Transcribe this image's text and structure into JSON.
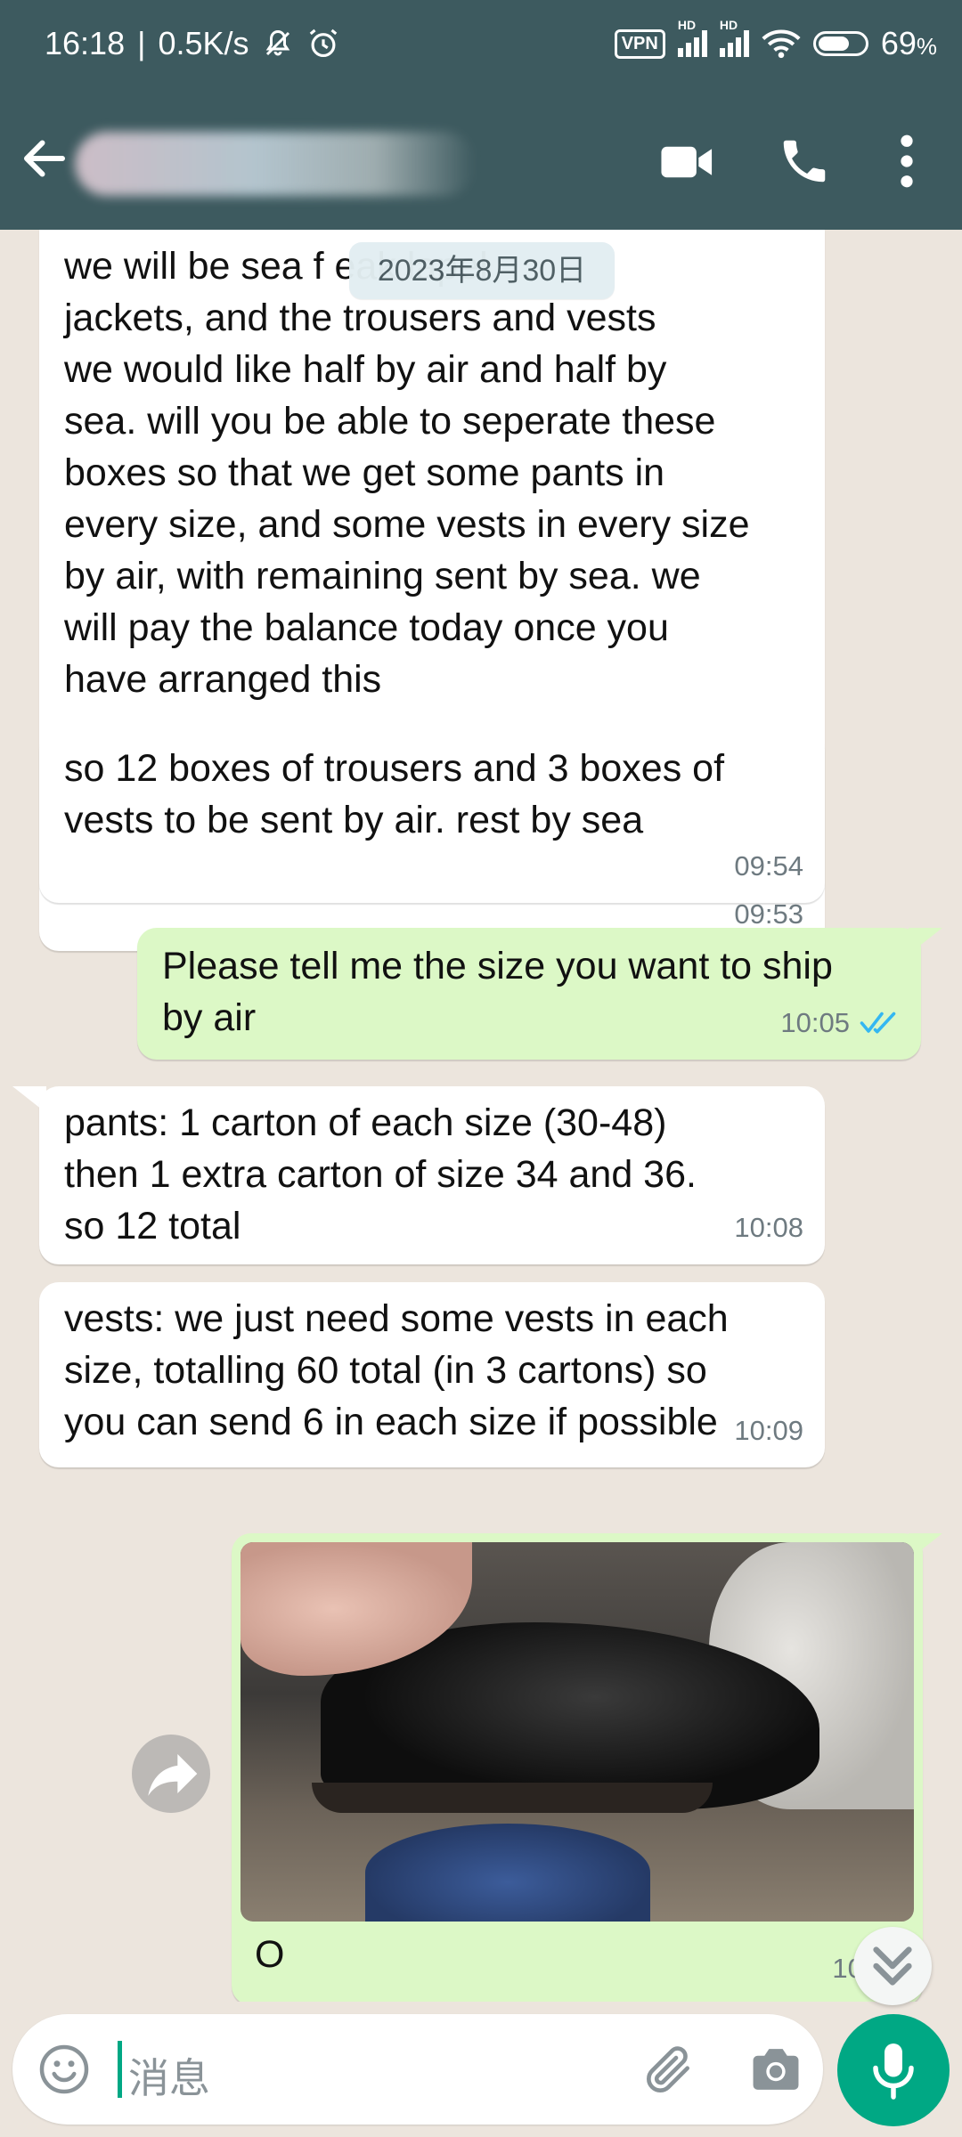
{
  "status_bar": {
    "time": "16:18",
    "speed": "0.5K/s",
    "vpn": "VPN",
    "hd1": "HD",
    "hd2": "HD",
    "battery": "69",
    "battery_unit": "%"
  },
  "header": {
    "contact_name": ""
  },
  "chat": {
    "date_chip": "2023年8月30日",
    "messages": [
      {
        "direction": "in",
        "text": "we will be sea f              eak lapel\njackets, and the trousers and vests\nwe would like half by air and half by\nsea. will you be able to seperate these\nboxes so that we get some pants in\nevery size, and some vests in every size\nby air, with remaining sent by sea. we\nwill pay the balance today once you\nhave arranged this",
        "time": "09:53"
      },
      {
        "direction": "in",
        "text": "so 12 boxes of trousers and 3 boxes of\nvests to be sent by air. rest by sea",
        "time": "09:54"
      },
      {
        "direction": "out",
        "text": "Please tell me the size you want to ship\nby air",
        "time": "10:05",
        "status": "read"
      },
      {
        "direction": "in",
        "text": "pants: 1 carton of each size (30-48)\nthen 1 extra carton of size 34 and 36.\nso 12 total",
        "time": "10:08"
      },
      {
        "direction": "in",
        "text": "vests: we just need some vests in each\nsize, totalling 60 total (in 3 cartons) so\nyou can send 6 in each size if possible",
        "time": "10:09"
      },
      {
        "direction": "out",
        "type": "image",
        "caption": "O",
        "time": "10:32",
        "status": "read"
      }
    ]
  },
  "composer": {
    "placeholder": "消息"
  },
  "icons": {
    "back": "arrow-left-icon",
    "video": "video-call-icon",
    "call": "phone-icon",
    "more": "more-vert-icon",
    "forward": "forward-icon",
    "scroll_down": "double-chevron-down-icon",
    "emoji": "emoji-icon",
    "attach": "paperclip-icon",
    "camera": "camera-icon",
    "mic": "mic-icon"
  },
  "colors": {
    "header": "#3d5a5f",
    "chat_background": "#ece5dd",
    "incoming_bubble": "#ffffff",
    "outgoing_bubble": "#dcf8c6",
    "accent": "#00a884",
    "read_tick": "#34b7f1"
  }
}
